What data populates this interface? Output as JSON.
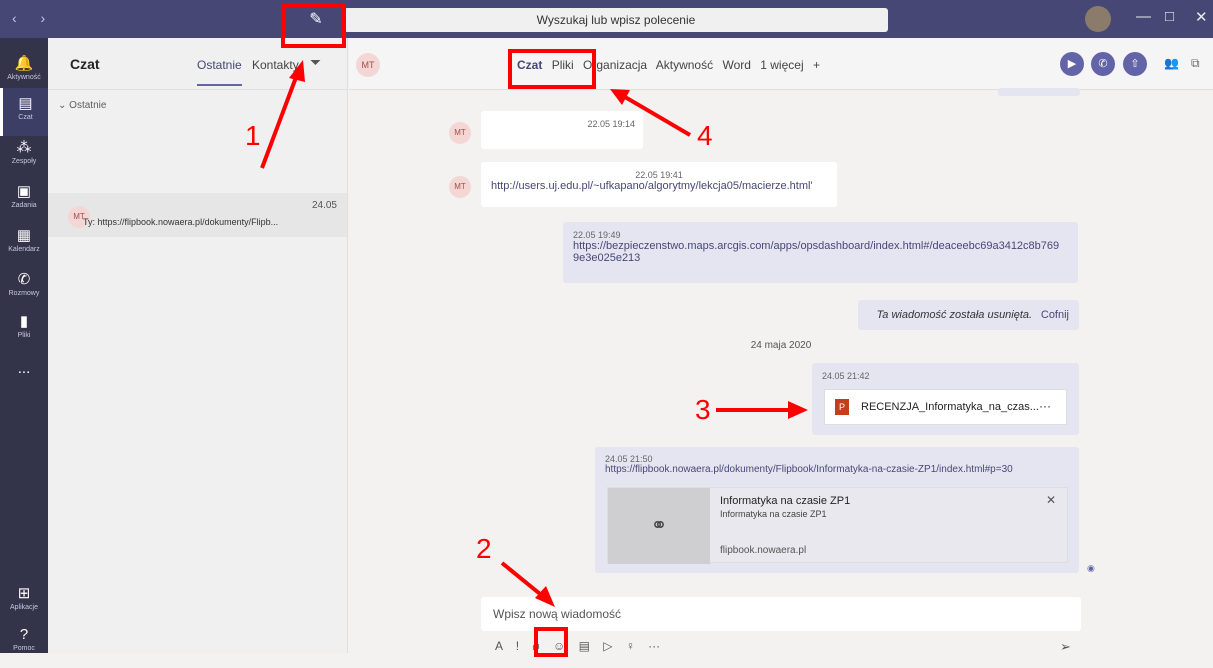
{
  "topbar": {
    "search_placeholder": "Wyszukaj lub wpisz polecenie",
    "compose_icon": "compose-icon"
  },
  "rail": [
    {
      "label": "Aktywność",
      "icon": "bell-icon"
    },
    {
      "label": "Czat",
      "icon": "chat-icon"
    },
    {
      "label": "Zespoły",
      "icon": "teams-icon"
    },
    {
      "label": "Zadania",
      "icon": "assignment-icon"
    },
    {
      "label": "Kalendarz",
      "icon": "calendar-icon"
    },
    {
      "label": "Rozmowy",
      "icon": "phone-icon"
    },
    {
      "label": "Pliki",
      "icon": "file-icon"
    },
    {
      "label": "...",
      "icon": "more-icon"
    },
    {
      "label": "Aplikacje",
      "icon": "apps-icon"
    },
    {
      "label": "Pomoc",
      "icon": "help-icon"
    }
  ],
  "chatlist": {
    "title": "Czat",
    "tab_recent": "Ostatnie",
    "tab_contacts": "Kontakty",
    "section": "Ostatnie",
    "item": {
      "initials": "MT",
      "date": "24.05",
      "preview": "Ty: https://flipbook.nowaera.pl/dokumenty/Flipb..."
    }
  },
  "header": {
    "initials": "MT",
    "tabs": [
      "Czat",
      "Pliki",
      "Organizacja",
      "Aktywność",
      "Word",
      "1 więcej"
    ],
    "plus": "+"
  },
  "messages": [
    {
      "time": "22.05 19:14",
      "text": ""
    },
    {
      "time": "22.05 19:41",
      "text": "http://users.uj.edu.pl/~ufkapano/algorytmy/lekcja05/macierze.html'"
    },
    {
      "time": "22.05 19:49",
      "text": "https://bezpieczenstwo.maps.arcgis.com/apps/opsdashboard/index.html#/deaceebc69a3412c8b769",
      "text2": "9e3e025e213"
    },
    {
      "deleted": "Ta wiadomość została usunięta.",
      "undo": "Cofnij"
    }
  ],
  "date_separator": "24 maja 2020",
  "file_message": {
    "time": "24.05 21:42",
    "filename": "RECENZJA_Informatyka_na_czas...",
    "more": "···"
  },
  "link_message": {
    "time": "24.05 21:50",
    "url": "https://flipbook.nowaera.pl/dokumenty/Flipbook/Informatyka-na-czasie-ZP1/index.html#p=30",
    "card_title": "Informatyka na czasie ZP1",
    "card_sub": "Informatyka na czasie ZP1",
    "card_domain": "flipbook.nowaera.pl"
  },
  "composer": {
    "placeholder": "Wpisz nową wiadomość"
  },
  "annotations": [
    "1",
    "2",
    "3",
    "4"
  ]
}
